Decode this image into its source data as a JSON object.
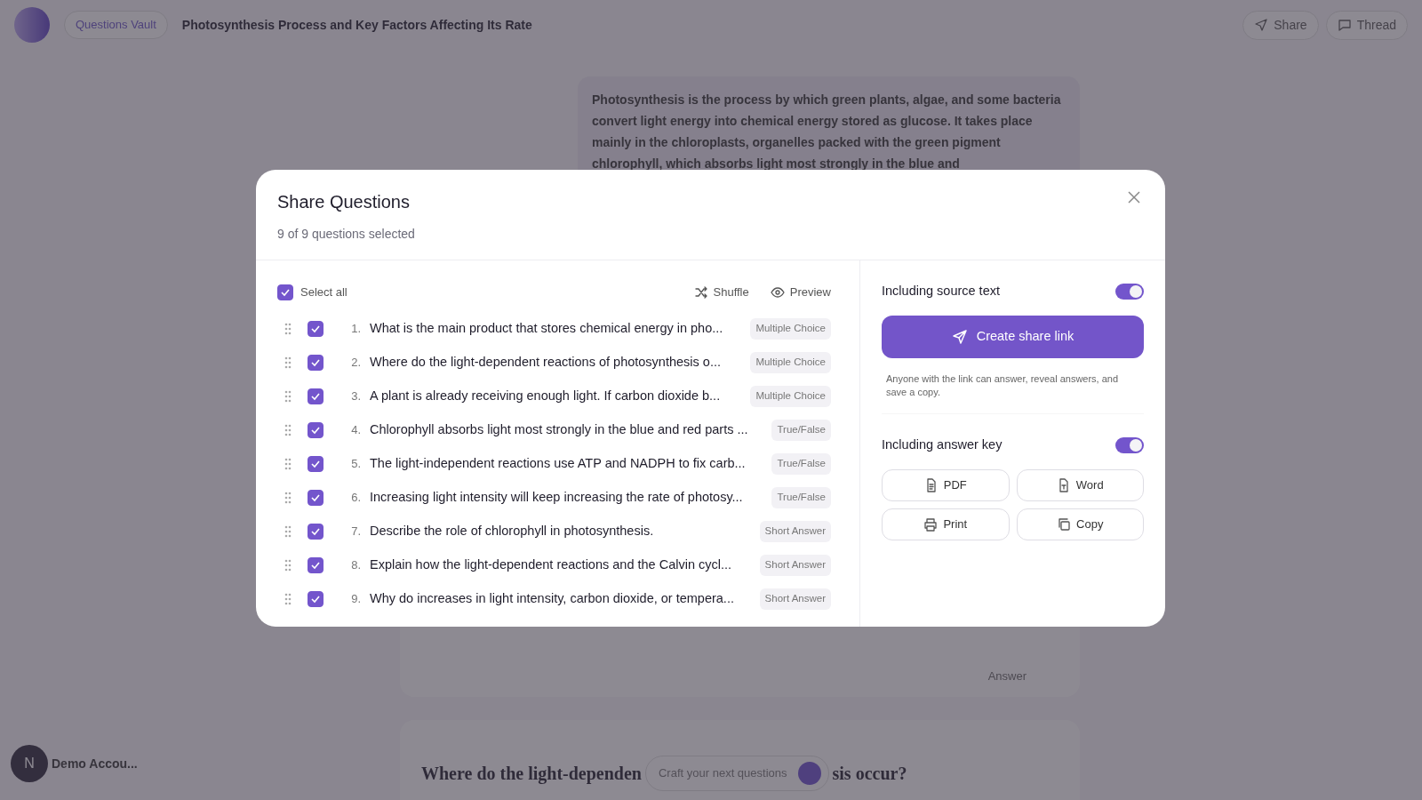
{
  "app_bar": {
    "vault_menu": "Questions Vault",
    "title": "Photosynthesis Process and Key Factors Affecting Its Rate",
    "buttons": [
      {
        "label": "Share",
        "kind": "share"
      },
      {
        "label": "Thread",
        "kind": "thread"
      }
    ]
  },
  "source_text": "Photosynthesis is the process by which green plants, algae, and some bacteria convert light energy into chemical energy stored as glucose. It takes place mainly in the chloroplasts, organelles packed with the green pigment chlorophyll, which absorbs light most strongly in the blue and",
  "answer_bar": {
    "label": "Answer"
  },
  "next_question": {
    "heading_start": "Where do the light-dependen",
    "heading_end": "sis occur?",
    "prompt_placeholder": "Craft your next questions"
  },
  "account": {
    "initial": "N",
    "name": "Demo Accou..."
  },
  "dialog": {
    "title": "Share Questions",
    "subtitle": "9 of 9 questions selected",
    "select_all": {
      "label": "Select all",
      "checked": true
    },
    "actions": [
      {
        "label": "Shuffle",
        "kind": "shuffle"
      },
      {
        "label": "Preview",
        "kind": "preview"
      }
    ],
    "questions": [
      {
        "number": "1.",
        "text": "What is the main product that stores chemical energy in pho...",
        "type": "Multiple Choice",
        "checked": true
      },
      {
        "number": "2.",
        "text": "Where do the light-dependent reactions of photosynthesis o...",
        "type": "Multiple Choice",
        "checked": true
      },
      {
        "number": "3.",
        "text": "A plant is already receiving enough light. If carbon dioxide b...",
        "type": "Multiple Choice",
        "checked": true
      },
      {
        "number": "4.",
        "text": "Chlorophyll absorbs light most strongly in the blue and red parts ...",
        "type": "True/False",
        "checked": true
      },
      {
        "number": "5.",
        "text": "The light-independent reactions use ATP and NADPH to fix carb...",
        "type": "True/False",
        "checked": true
      },
      {
        "number": "6.",
        "text": "Increasing light intensity will keep increasing the rate of photosy...",
        "type": "True/False",
        "checked": true
      },
      {
        "number": "7.",
        "text": "Describe the role of chlorophyll in photosynthesis.",
        "type": "Short Answer",
        "checked": true
      },
      {
        "number": "8.",
        "text": "Explain how the light-dependent reactions and the Calvin cycl...",
        "type": "Short Answer",
        "checked": true
      },
      {
        "number": "9.",
        "text": "Why do increases in light intensity, carbon dioxide, or tempera...",
        "type": "Short Answer",
        "checked": true
      }
    ],
    "source_toggle": {
      "label": "Including source text",
      "on": true
    },
    "share_button": "Create share link",
    "share_note": "Anyone with the link can answer, reveal answers, and save a copy.",
    "answer_key_toggle": {
      "label": "Including answer key",
      "on": true
    },
    "exports": [
      {
        "label": "PDF",
        "kind": "pdf"
      },
      {
        "label": "Word",
        "kind": "word"
      },
      {
        "label": "Print",
        "kind": "print"
      },
      {
        "label": "Copy",
        "kind": "copy"
      }
    ]
  }
}
